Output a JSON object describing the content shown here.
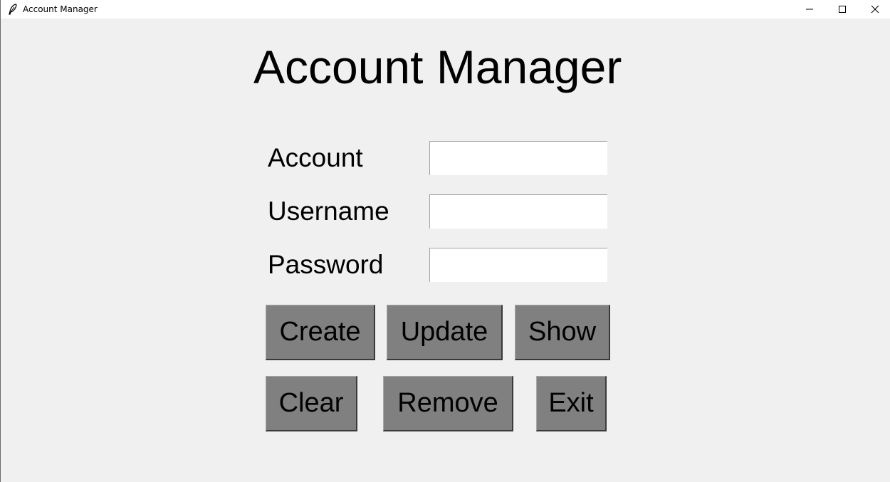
{
  "window": {
    "title": "Account Manager",
    "app_icon": "feather-icon",
    "controls": {
      "minimize": "minimize-icon",
      "maximize": "maximize-icon",
      "close": "close-icon"
    }
  },
  "main": {
    "heading": "Account Manager",
    "fields": [
      {
        "label": "Account",
        "value": "",
        "placeholder": ""
      },
      {
        "label": "Username",
        "value": "",
        "placeholder": ""
      },
      {
        "label": "Password",
        "value": "",
        "placeholder": ""
      }
    ],
    "buttons": {
      "create": "Create",
      "update": "Update",
      "show": "Show",
      "clear": "Clear",
      "remove": "Remove",
      "exit": "Exit"
    }
  },
  "colors": {
    "background": "#f0f0f0",
    "button_face": "#808080",
    "input_background": "#ffffff"
  }
}
